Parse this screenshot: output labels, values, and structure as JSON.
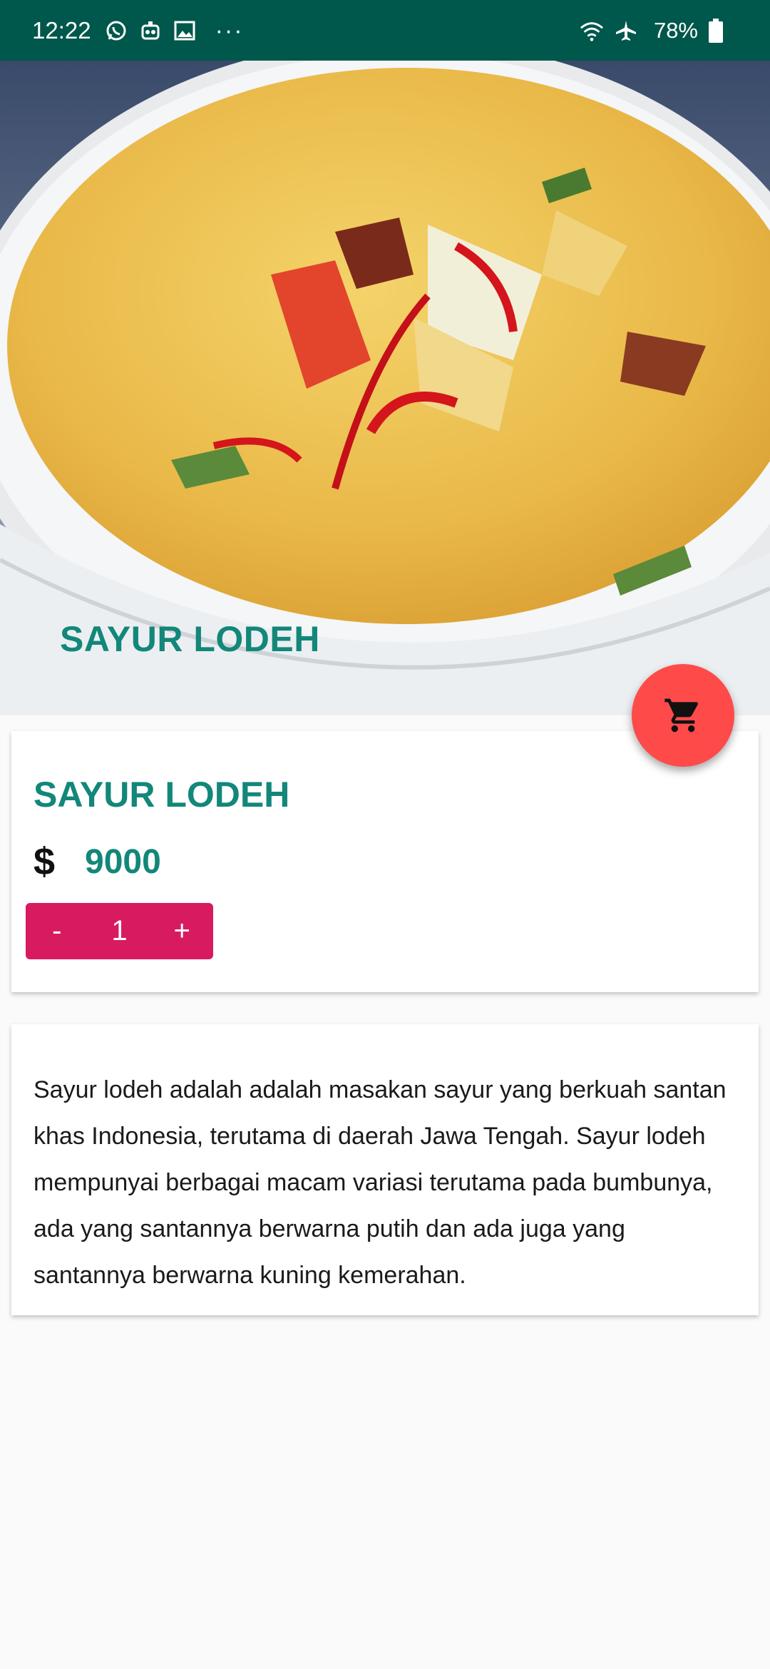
{
  "status_bar": {
    "time": "12:22",
    "battery": "78%",
    "icons": [
      "whatsapp-icon",
      "robot-icon",
      "image-icon",
      "wifi-icon",
      "airplane-icon",
      "battery-icon"
    ],
    "overflow": "···"
  },
  "hero": {
    "title": "SAYUR LODEH"
  },
  "product": {
    "name": "SAYUR LODEH",
    "currency": "$",
    "price": "9000",
    "quantity": "1",
    "minus_label": "-",
    "plus_label": "+"
  },
  "description": "Sayur lodeh adalah adalah masakan sayur yang berkuah santan khas Indonesia, terutama di daerah Jawa Tengah. Sayur lodeh mempunyai berbagai macam variasi terutama pada bumbunya, ada yang santannya berwarna putih dan ada juga yang santannya berwarna kuning kemerahan.",
  "fab": {
    "icon": "cart-icon"
  },
  "colors": {
    "status_bar": "#00574b",
    "accent": "#12877a",
    "fab": "#ff4a4a",
    "stepper": "#d81b60"
  }
}
